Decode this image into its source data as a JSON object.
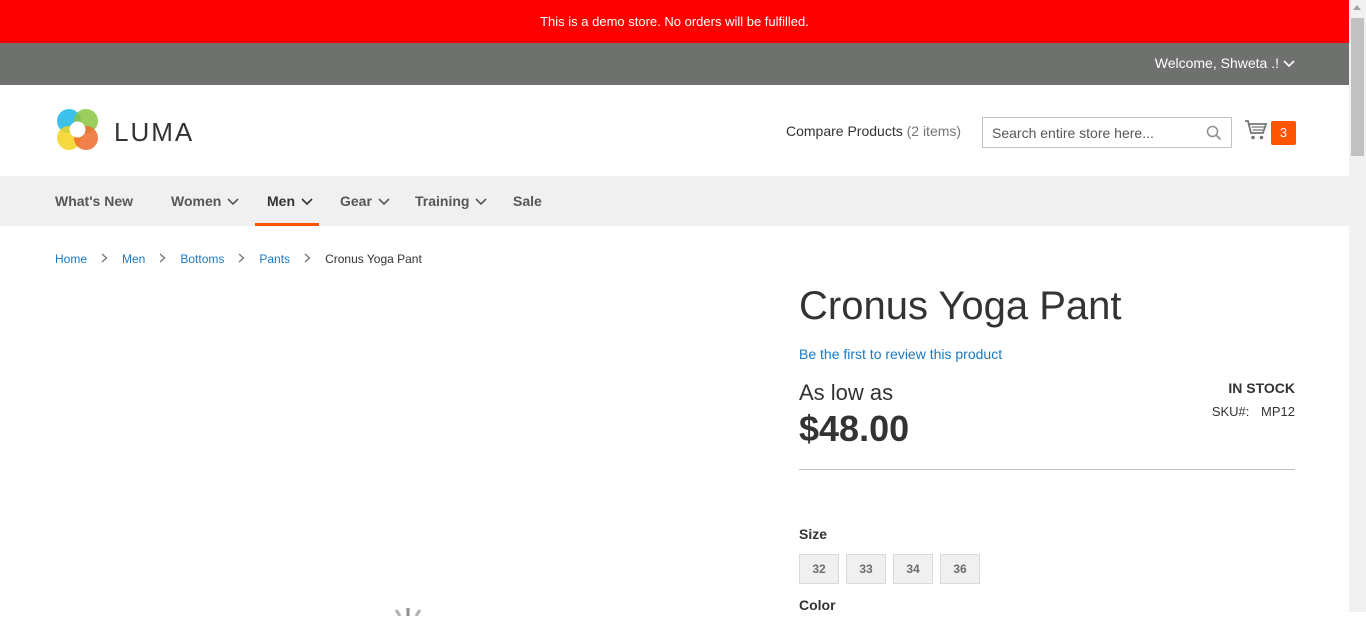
{
  "demo_notice": "This is a demo store. No orders will be fulfilled.",
  "panel": {
    "welcome": "Welcome, Shweta .!"
  },
  "header": {
    "logo_text": "LUMA",
    "compare_label": "Compare Products",
    "compare_count": "(2 items)",
    "search_placeholder": "Search entire store here...",
    "cart_count": "3"
  },
  "nav": {
    "items": [
      {
        "label": "What's New"
      },
      {
        "label": "Women"
      },
      {
        "label": "Men"
      },
      {
        "label": "Gear"
      },
      {
        "label": "Training"
      },
      {
        "label": "Sale"
      }
    ]
  },
  "breadcrumbs": {
    "items": [
      {
        "label": "Home"
      },
      {
        "label": "Men"
      },
      {
        "label": "Bottoms"
      },
      {
        "label": "Pants"
      },
      {
        "label": "Cronus Yoga Pant"
      }
    ]
  },
  "product": {
    "title": "Cronus Yoga Pant",
    "review_link": "Be the first to review this product",
    "as_low_as": "As low as",
    "price": "$48.00",
    "stock": "IN STOCK",
    "sku_label": "SKU#:",
    "sku_value": "MP12",
    "size_label": "Size",
    "sizes": [
      "32",
      "33",
      "34",
      "36"
    ],
    "color_label": "Color"
  },
  "colors": {
    "demo_bar": "#ff0000",
    "panel_bar": "#6e716e",
    "accent": "#ff5501",
    "link": "#1979c3"
  }
}
